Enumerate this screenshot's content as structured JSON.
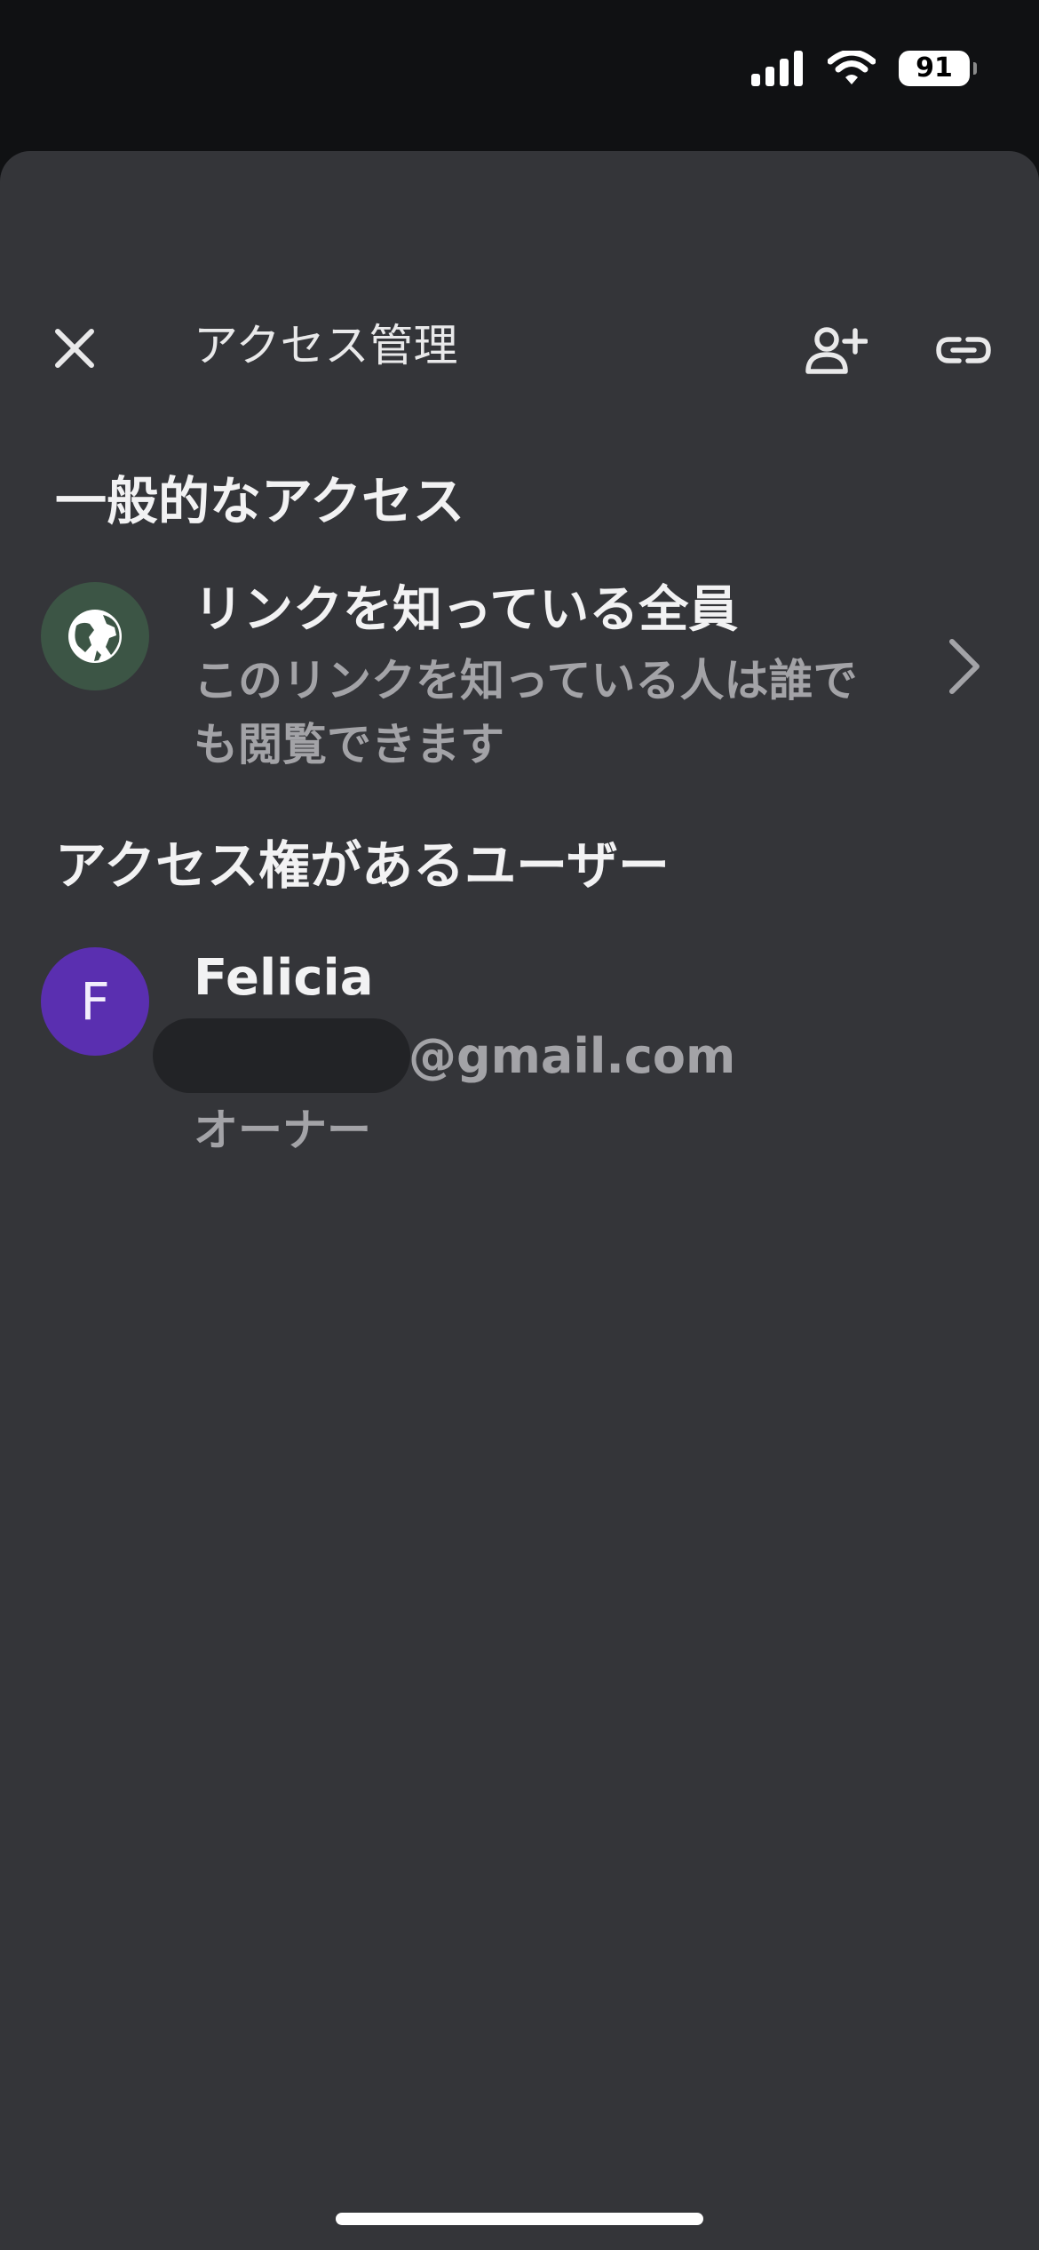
{
  "status_bar": {
    "battery": "91",
    "icons": [
      "signal-icon",
      "wifi-icon",
      "battery-icon"
    ]
  },
  "header": {
    "close_icon": "close-icon",
    "title": "アクセス管理",
    "add_person_icon": "person-add-icon",
    "link_icon": "link-icon"
  },
  "general_access": {
    "heading": "一般的なアクセス",
    "option_title": "リンクを知っている全員",
    "option_description": "このリンクを知っている人は誰でも閲覧できます",
    "icon": "globe-icon",
    "chevron": "chevron-right-icon"
  },
  "users_section": {
    "heading": "アクセス権があるユーザー",
    "users": [
      {
        "initial": "F",
        "name": "Felicia",
        "email_domain": "@gmail.com",
        "role": "オーナー"
      }
    ]
  },
  "colors": {
    "background": "#101113",
    "sheet": "#343539",
    "globe_avatar": "#3c5545",
    "user_avatar": "#5a2fb0",
    "secondary_text": "#a3a3a7"
  }
}
